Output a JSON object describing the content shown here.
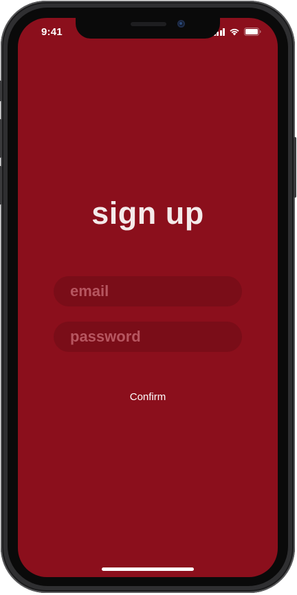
{
  "status_bar": {
    "time": "9:41",
    "icons": [
      "signal-icon",
      "wifi-icon",
      "battery-icon"
    ]
  },
  "signup": {
    "title": "sign up",
    "email_placeholder": "email",
    "password_placeholder": "password",
    "confirm_label": "Confirm"
  },
  "colors": {
    "background": "#8b0f1c",
    "field_background": "#7a0d18",
    "placeholder_text": "#b75660",
    "title_text": "#f4eaea",
    "button_text": "#ffffff"
  }
}
